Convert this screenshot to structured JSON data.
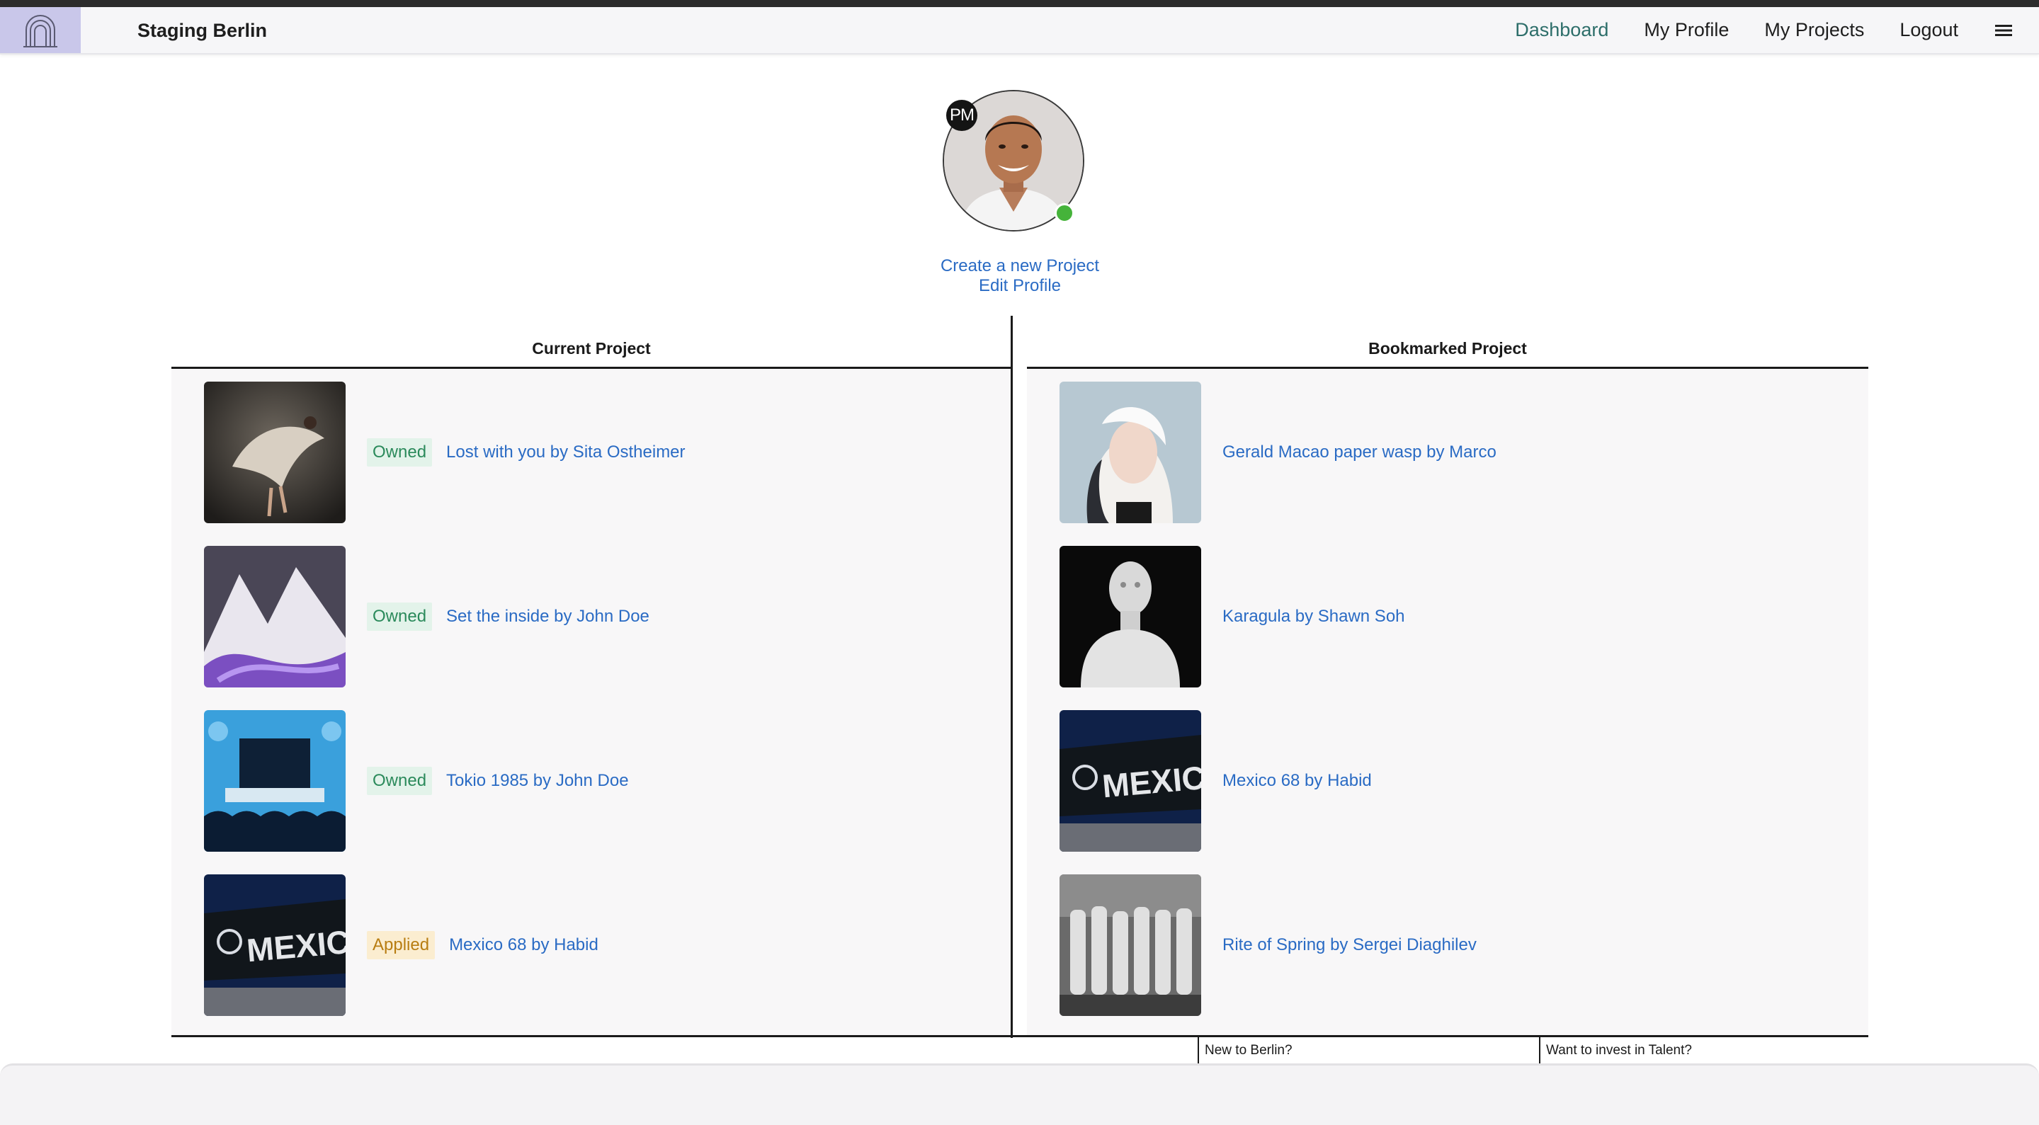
{
  "app": {
    "brand": "Staging Berlin",
    "logo_icon": "arch-logo-icon"
  },
  "nav": {
    "items": [
      {
        "label": "Dashboard",
        "active": true
      },
      {
        "label": "My Profile",
        "active": false
      },
      {
        "label": "My Projects",
        "active": false
      },
      {
        "label": "Logout",
        "active": false
      }
    ],
    "menu_icon": "hamburger-icon",
    "active_color": "#2d6e6a"
  },
  "profile": {
    "initials": "PM",
    "status": "online",
    "create_project_label": "Create a new Project",
    "edit_profile_label": "Edit Profile"
  },
  "current_projects": {
    "heading": "Current Project",
    "items": [
      {
        "badge": "Owned",
        "title": "Lost with you by Sita Ostheimer"
      },
      {
        "badge": "Owned",
        "title": "Set the inside by John Doe"
      },
      {
        "badge": "Owned",
        "title": "Tokio 1985 by John Doe"
      },
      {
        "badge": "Applied",
        "title": "Mexico 68 by Habid"
      }
    ]
  },
  "bookmarked_projects": {
    "heading": "Bookmarked Project",
    "items": [
      {
        "title": "Gerald Macao paper wasp by Marco"
      },
      {
        "title": "Karagula by Shawn Soh"
      },
      {
        "title": "Mexico 68 by Habid"
      },
      {
        "title": "Rite of Spring by Sergei Diaghilev"
      }
    ]
  },
  "footer": {
    "link_1": "New to Berlin?",
    "link_2": "Want to invest in Talent?"
  },
  "colors": {
    "link": "#2a6bc4",
    "owned_bg": "#e3f3ea",
    "owned_text": "#2b8a5b",
    "applied_bg": "#fbedd0",
    "applied_text": "#b87d12",
    "online": "#45b33a"
  }
}
